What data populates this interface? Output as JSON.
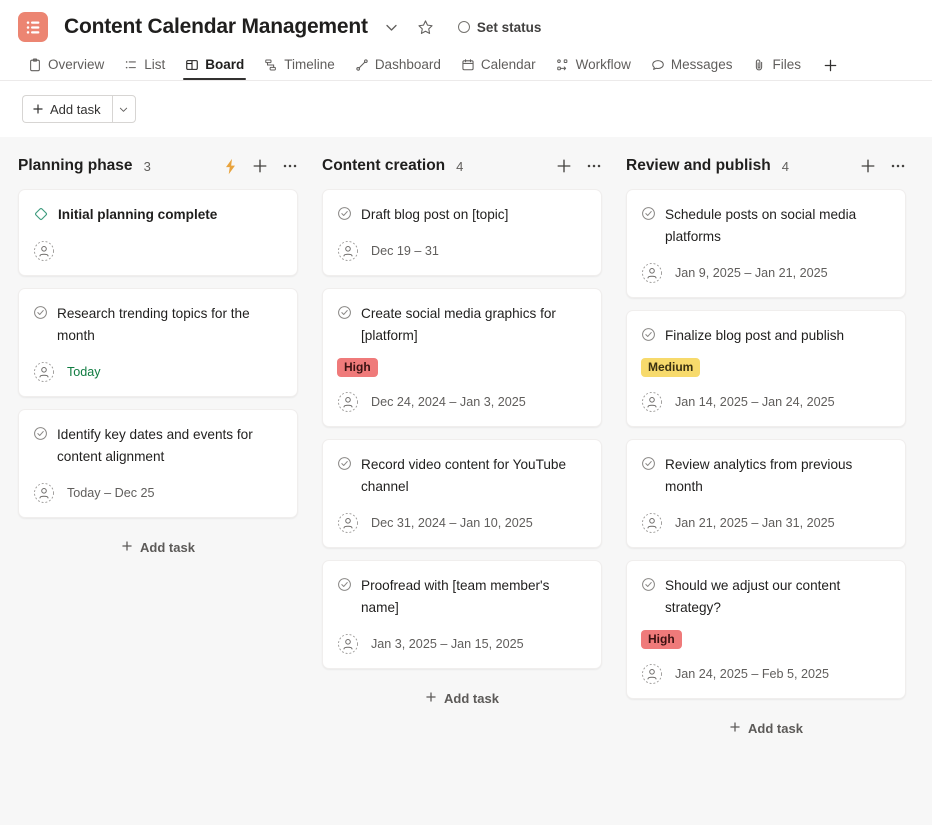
{
  "titlebar": {
    "logo_icon": "list-app-logo-icon",
    "logo_color": "#ec8572",
    "title": "Content Calendar Management",
    "chevron_icon": "chevron-down-icon",
    "favorite_icon": "star-icon",
    "set_status_label": "Set status"
  },
  "tabs": [
    {
      "label": "Overview",
      "icon": "clipboard-icon",
      "active": false
    },
    {
      "label": "List",
      "icon": "list-icon",
      "active": false
    },
    {
      "label": "Board",
      "icon": "board-icon",
      "active": true
    },
    {
      "label": "Timeline",
      "icon": "timeline-icon",
      "active": false
    },
    {
      "label": "Dashboard",
      "icon": "dashboard-icon",
      "active": false
    },
    {
      "label": "Calendar",
      "icon": "calendar-icon",
      "active": false
    },
    {
      "label": "Workflow",
      "icon": "workflow-icon",
      "active": false
    },
    {
      "label": "Messages",
      "icon": "chat-icon",
      "active": false
    },
    {
      "label": "Files",
      "icon": "paperclip-icon",
      "active": false
    }
  ],
  "tab_add_label": "+",
  "toolbar": {
    "add_task_label": "Add task",
    "add_task_caret_icon": "chevron-down-icon"
  },
  "board": {
    "add_task_footer_label": "Add task",
    "columns": [
      {
        "title": "Planning phase",
        "count": "3",
        "has_lightning": true,
        "show_footer_add": true,
        "cards": [
          {
            "title": "Initial planning complete",
            "icon": "milestone-diamond-icon",
            "milestone": true,
            "priority": null,
            "date": null,
            "date_green": false
          },
          {
            "title": "Research trending topics for the month",
            "icon": "task-check-icon",
            "milestone": false,
            "priority": null,
            "date": "Today",
            "date_green": true
          },
          {
            "title": "Identify key dates and events for content alignment",
            "icon": "task-check-icon",
            "milestone": false,
            "priority": null,
            "date": "Today – Dec 25",
            "date_green": false
          }
        ]
      },
      {
        "title": "Content creation",
        "count": "4",
        "has_lightning": false,
        "show_footer_add": true,
        "cards": [
          {
            "title": "Draft blog post on [topic]",
            "icon": "task-check-icon",
            "milestone": false,
            "priority": null,
            "date": "Dec 19 – 31",
            "date_green": false
          },
          {
            "title": "Create social media graphics for [platform]",
            "icon": "task-check-icon",
            "milestone": false,
            "priority": "High",
            "priority_level": "high",
            "date": "Dec 24, 2024 – Jan 3, 2025",
            "date_green": false
          },
          {
            "title": "Record video content for YouTube channel",
            "icon": "task-check-icon",
            "milestone": false,
            "priority": null,
            "date": "Dec 31, 2024 – Jan 10, 2025",
            "date_green": false
          },
          {
            "title": "Proofread with [team member's name]",
            "icon": "task-check-icon",
            "milestone": false,
            "priority": null,
            "date": "Jan 3, 2025 – Jan 15, 2025",
            "date_green": false
          }
        ]
      },
      {
        "title": "Review and publish",
        "count": "4",
        "has_lightning": false,
        "show_footer_add": true,
        "cards": [
          {
            "title": "Schedule posts on social media platforms",
            "icon": "task-check-icon",
            "milestone": false,
            "priority": null,
            "date": "Jan 9, 2025 – Jan 21, 2025",
            "date_green": false
          },
          {
            "title": "Finalize blog post and publish",
            "icon": "task-check-icon",
            "milestone": false,
            "priority": "Medium",
            "priority_level": "medium",
            "date": "Jan 14, 2025 – Jan 24, 2025",
            "date_green": false
          },
          {
            "title": "Review analytics from previous month",
            "icon": "task-check-icon",
            "milestone": false,
            "priority": null,
            "date": "Jan 21, 2025 – Jan 31, 2025",
            "date_green": false
          },
          {
            "title": "Should we adjust our content strategy?",
            "icon": "task-check-icon",
            "milestone": false,
            "priority": "High",
            "priority_level": "high",
            "date": "Jan 24, 2025 – Feb 5, 2025",
            "date_green": false
          }
        ]
      }
    ]
  },
  "colors": {
    "accent": "#ec8572",
    "milestone": "#3f9c7f",
    "lightning": "#e8a33d",
    "high_bg": "#ef7a7a",
    "medium_bg": "#f7da6c",
    "due_today": "#107c41",
    "board_bg": "#f7f7f7"
  }
}
